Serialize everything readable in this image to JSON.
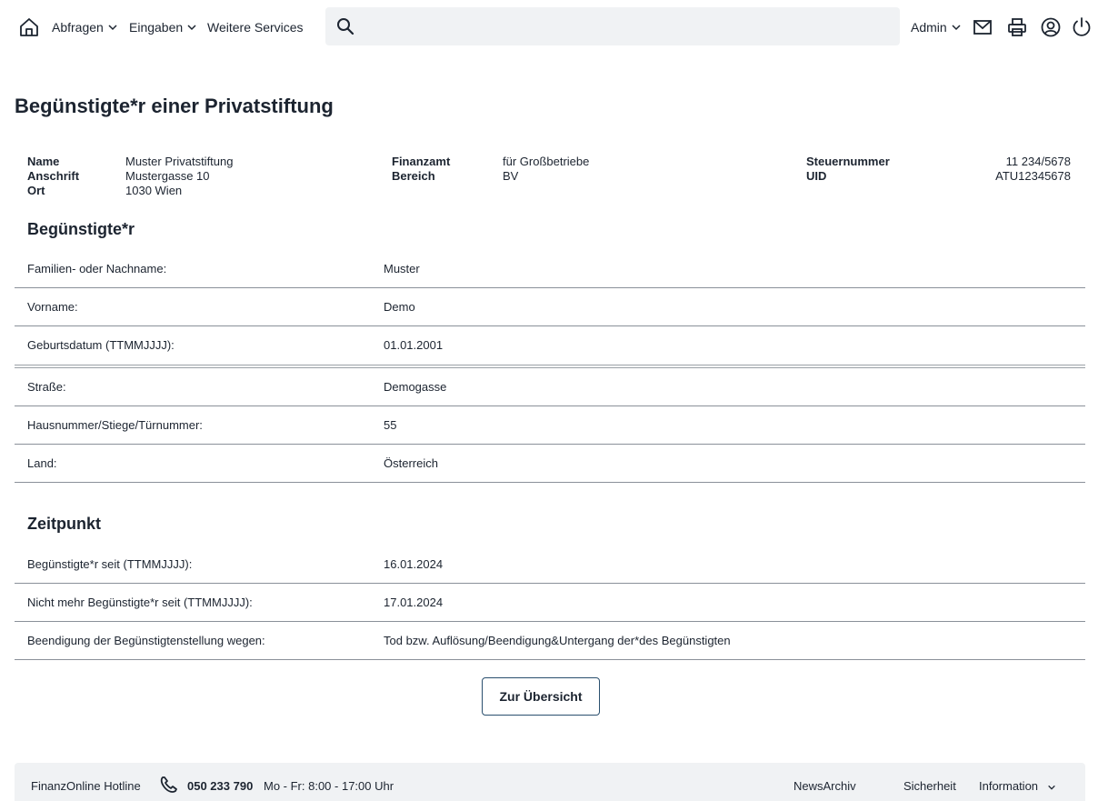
{
  "nav": {
    "home_icon": "home-icon",
    "items": [
      {
        "label": "Abfragen",
        "has_dropdown": true
      },
      {
        "label": "Eingaben",
        "has_dropdown": true
      },
      {
        "label": "Weitere Services",
        "has_dropdown": false
      }
    ],
    "search_placeholder": "",
    "admin_label": "Admin",
    "tools": [
      "mail-icon",
      "printer-icon",
      "user-icon",
      "power-icon"
    ]
  },
  "page": {
    "title": "Begünstigte*r einer Privatstiftung"
  },
  "meta": {
    "col1": [
      {
        "label": "Name",
        "value": "Muster Privatstiftung"
      },
      {
        "label": "Anschrift",
        "value": "Mustergasse 10"
      },
      {
        "label": "Ort",
        "value": "1030 Wien"
      }
    ],
    "col2": [
      {
        "label": "Finanzamt",
        "value": "für Großbetriebe"
      },
      {
        "label": "Bereich",
        "value": "BV"
      }
    ],
    "col3": [
      {
        "label": "Steuernummer",
        "value": "11 234/5678"
      },
      {
        "label": "UID",
        "value": "ATU12345678"
      }
    ]
  },
  "beneficiary": {
    "heading": "Begünstigte*r",
    "rows": [
      {
        "label": "Familien- oder Nachname:",
        "value": "Muster"
      },
      {
        "label": "Vorname:",
        "value": "Demo"
      },
      {
        "label": "Geburtsdatum (TTMMJJJJ):",
        "value": "01.01.2001"
      },
      {
        "label": "Straße:",
        "value": "Demogasse"
      },
      {
        "label": "Hausnummer/Stiege/Türnummer:",
        "value": "55"
      },
      {
        "label": "Land:",
        "value": "Österreich"
      }
    ]
  },
  "timing": {
    "heading": "Zeitpunkt",
    "rows": [
      {
        "label": "Begünstigte*r seit (TTMMJJJJ):",
        "value": "16.01.2024"
      },
      {
        "label": "Nicht mehr Begünstigte*r seit (TTMMJJJJ):",
        "value": "17.01.2024"
      },
      {
        "label": "Beendigung der Begünstigtenstellung wegen:",
        "value": "Tod bzw. Auflösung/Beendigung&Untergang der*des Begünstigten"
      }
    ]
  },
  "actions": {
    "overview_label": "Zur Übersicht"
  },
  "footer": {
    "hotline_label": "FinanzOnline Hotline",
    "phone_number": "050 233 790",
    "hours": "Mo - Fr: 8:00 - 17:00 Uhr",
    "links": [
      "NewsArchiv",
      "Sicherheit",
      "Information"
    ]
  }
}
